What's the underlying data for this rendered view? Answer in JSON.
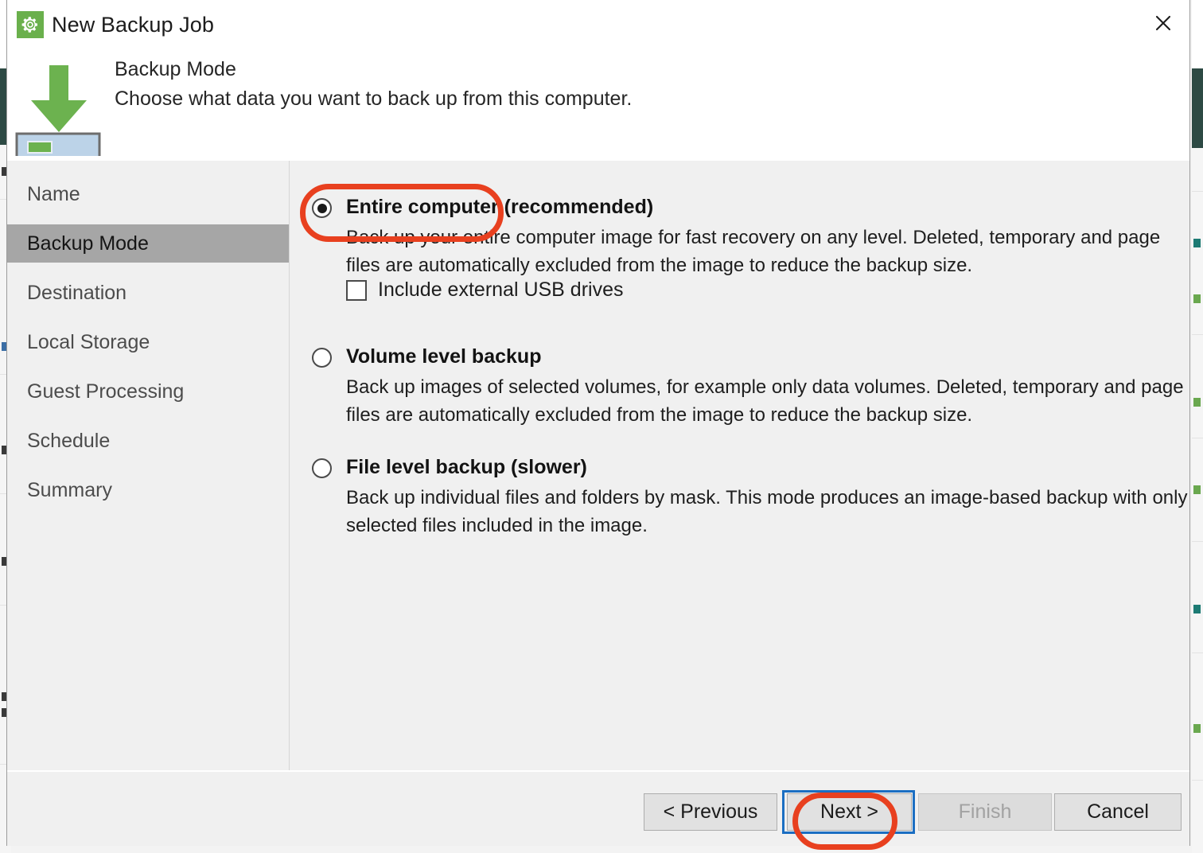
{
  "window": {
    "title": "New Backup Job",
    "title_icon": "gear-icon",
    "close_icon": "close-icon"
  },
  "header": {
    "title": "Backup Mode",
    "subtitle": "Choose what data you want to back up from this computer.",
    "icon": "backup-download-arrow-icon"
  },
  "sidebar": {
    "items": [
      {
        "label": "Name",
        "active": false
      },
      {
        "label": "Backup Mode",
        "active": true
      },
      {
        "label": "Destination",
        "active": false
      },
      {
        "label": "Local Storage",
        "active": false
      },
      {
        "label": "Guest Processing",
        "active": false
      },
      {
        "label": "Schedule",
        "active": false
      },
      {
        "label": "Summary",
        "active": false
      }
    ]
  },
  "content": {
    "options": [
      {
        "title": "Entire computer (recommended)",
        "description": "Back up your entire computer image for fast recovery on any level. Deleted, temporary and page files are automatically excluded from the image to reduce the backup size.",
        "selected": true,
        "sub_checkbox": {
          "label": "Include external USB drives",
          "checked": false
        }
      },
      {
        "title": "Volume level backup",
        "description": "Back up images of selected volumes, for example only data volumes. Deleted, temporary and page files are automatically excluded from the image to reduce the backup size.",
        "selected": false
      },
      {
        "title": "File level backup (slower)",
        "description": "Back up individual files and folders by mask. This mode produces an image-based backup with only selected files included in the image.",
        "selected": false
      }
    ]
  },
  "footer": {
    "previous_label": "< Previous",
    "next_label": "Next >",
    "finish_label": "Finish",
    "cancel_label": "Cancel",
    "finish_disabled": true,
    "next_focused": true
  },
  "annotations": {
    "color": "#e8401f",
    "targets": [
      "entire-computer-radio-option",
      "next-button"
    ]
  },
  "colors": {
    "accent_green": "#6ab04c",
    "annotation_red": "#e8401f",
    "focus_blue": "#1b6ec2",
    "sidebar_active": "#a6a6a6",
    "panel_background": "#f0f0f0"
  }
}
